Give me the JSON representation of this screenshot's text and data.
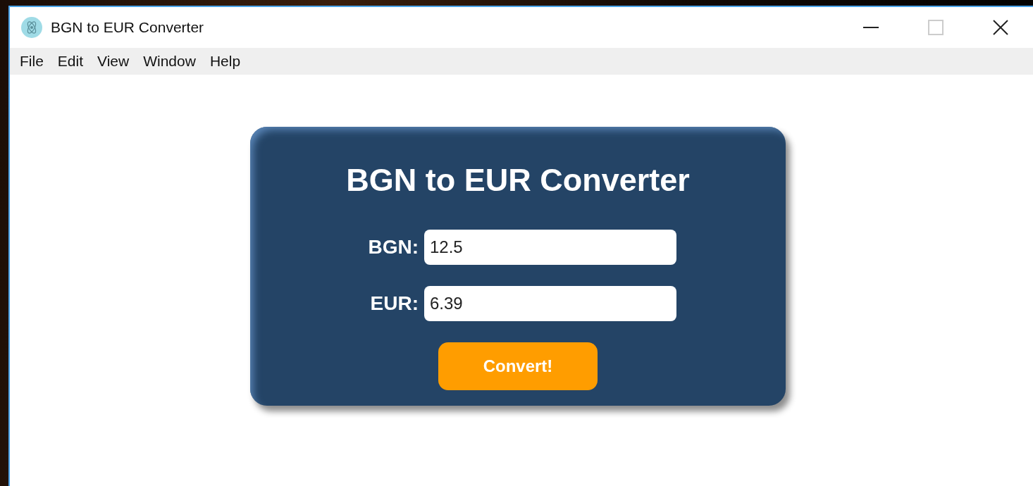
{
  "window": {
    "title": "BGN to EUR Converter"
  },
  "menu": [
    "File",
    "Edit",
    "View",
    "Window",
    "Help"
  ],
  "converter": {
    "heading": "BGN to EUR Converter",
    "fields": [
      {
        "label": "BGN:",
        "value": "12.5"
      },
      {
        "label": "EUR:",
        "value": "6.39"
      }
    ],
    "button": "Convert!"
  }
}
